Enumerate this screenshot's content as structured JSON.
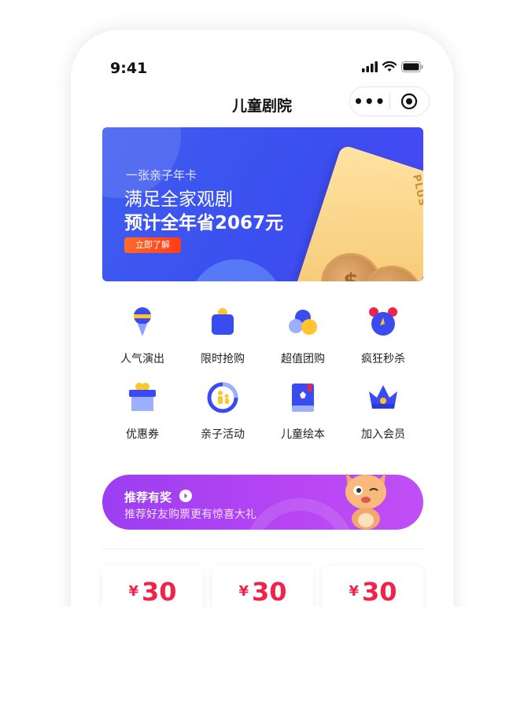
{
  "status": {
    "time": "9:41"
  },
  "nav": {
    "title": "儿童剧院",
    "more_icon": "more-dots-icon",
    "close_icon": "target-close-icon"
  },
  "banner": {
    "subtitle": "一张亲子年卡",
    "line1": "满足全家观剧",
    "line2": "预计全年省2067元",
    "cta": "立即了解",
    "card_label": "PLUS",
    "colors": {
      "background": "#3f5df0",
      "cta": "#ff4a1f",
      "card": "#f4c46a"
    }
  },
  "grid": [
    {
      "label": "人气演出",
      "icon": "balloon-icon"
    },
    {
      "label": "限时抢购",
      "icon": "shopping-bag-icon"
    },
    {
      "label": "超值团购",
      "icon": "group-circles-icon"
    },
    {
      "label": "疯狂秒杀",
      "icon": "alarm-clock-icon"
    },
    {
      "label": "优惠券",
      "icon": "gift-box-icon"
    },
    {
      "label": "亲子活动",
      "icon": "parent-child-icon"
    },
    {
      "label": "儿童绘本",
      "icon": "picture-book-icon"
    },
    {
      "label": "加入会员",
      "icon": "crown-icon"
    }
  ],
  "promo": {
    "title": "推荐有奖",
    "subtitle": "推荐好友购票更有惊喜大礼",
    "color": "#b045f3"
  },
  "coupons": [
    {
      "currency": "¥",
      "amount": "30"
    },
    {
      "currency": "¥",
      "amount": "30"
    },
    {
      "currency": "¥",
      "amount": "30"
    }
  ]
}
